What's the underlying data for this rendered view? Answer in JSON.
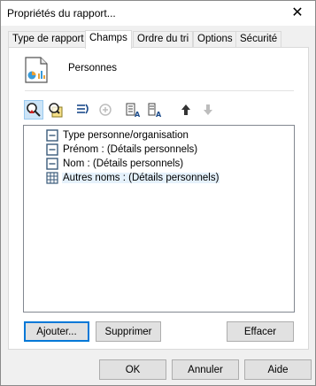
{
  "window": {
    "title": "Propriétés du rapport...",
    "close_glyph": "✕"
  },
  "tabs": [
    {
      "label": "Type de rapport",
      "active": false
    },
    {
      "label": "Champs",
      "active": true
    },
    {
      "label": "Ordre du tri",
      "active": false
    },
    {
      "label": "Options",
      "active": false
    },
    {
      "label": "Sécurité",
      "active": false
    }
  ],
  "report": {
    "name": "Personnes",
    "icon": "report-document-icon"
  },
  "toolbar": {
    "buttons": [
      {
        "icon": "find-field-icon",
        "pressed": true
      },
      {
        "icon": "field-properties-icon",
        "pressed": false
      },
      {
        "icon": "insert-field-icon",
        "pressed": false
      },
      {
        "icon": "add-field-disabled-icon",
        "pressed": false
      },
      {
        "icon": "text-format-icon",
        "pressed": false
      },
      {
        "icon": "column-format-icon",
        "pressed": false
      },
      {
        "icon": "move-up-icon",
        "pressed": false
      },
      {
        "icon": "move-down-disabled-icon",
        "pressed": false
      }
    ]
  },
  "fields": [
    {
      "label": "Type personne/organisation",
      "icon": "field-icon",
      "selected": false
    },
    {
      "label": "Prénom : (Détails personnels)",
      "icon": "field-icon",
      "selected": false
    },
    {
      "label": "Nom : (Détails personnels)",
      "icon": "field-icon",
      "selected": false
    },
    {
      "label": "Autres noms : (Détails personnels)",
      "icon": "table-field-icon",
      "selected": true
    }
  ],
  "buttons": {
    "add": "Ajouter...",
    "delete": "Supprimer",
    "clear": "Effacer",
    "ok": "OK",
    "cancel": "Annuler",
    "help": "Aide"
  },
  "colors": {
    "accent": "#0078d7",
    "selection": "#e5f1fb"
  }
}
